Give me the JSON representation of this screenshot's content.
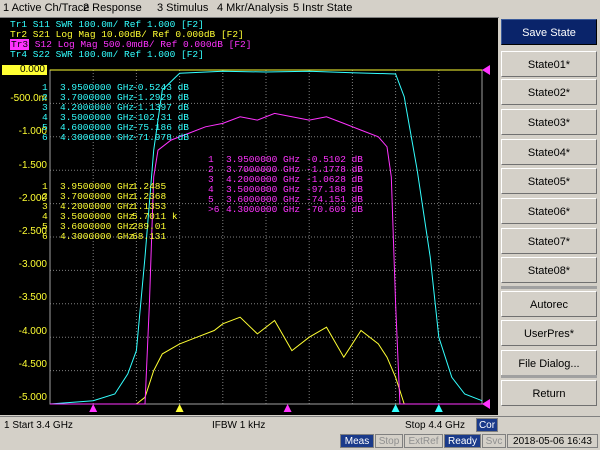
{
  "menu": [
    "1 Active Ch/Trace",
    "2 Response",
    "3 Stimulus",
    "4 Mkr/Analysis",
    "5 Instr State"
  ],
  "traces": [
    {
      "label": "Tr1",
      "text": " S11  SWR 100.0m/ Ref 1.000  [F2]",
      "color": "#33ffff"
    },
    {
      "label": "Tr2",
      "text": " S21  Log Mag 10.00dB/ Ref 0.000dB  [F2]",
      "color": "#ffff33"
    },
    {
      "label": "Tr3",
      "text": " S12  Log Mag 500.0mdB/ Ref 0.000dB  [F2]",
      "color": "#ff33ff"
    },
    {
      "label": "Tr4",
      "text": " S22  SWR 100.0m/ Ref 1.000  [F2]",
      "color": "#33ffff"
    }
  ],
  "y_axis": {
    "top_label": "0.000",
    "labels": [
      "-500.0m",
      "-1.000",
      "-1.500",
      "-2.000",
      "-2.500",
      "-3.000",
      "-3.500",
      "-4.000",
      "-4.500",
      "-5.000"
    ]
  },
  "marker_tables": {
    "cyan": {
      "color": "#33ffff",
      "rows": [
        {
          "n": "1",
          "f": "3.9500000 GHz",
          "v": "-0.5243 dB"
        },
        {
          "n": "2",
          "f": "3.7000000 GHz",
          "v": "-1.2929 dB"
        },
        {
          "n": "3",
          "f": "4.2000000 GHz",
          "v": "-1.1397 dB"
        },
        {
          "n": "4",
          "f": "3.5000000 GHz",
          "v": "-102.31 dB"
        },
        {
          "n": "5",
          "f": "4.6000000 GHz",
          "v": "-75.186 dB"
        },
        {
          "n": "6",
          "f": "4.3000000 GHz",
          "v": "-71.978 dB"
        }
      ]
    },
    "yellow": {
      "color": "#ffff33",
      "rows": [
        {
          "n": "1",
          "f": "3.9500000 GHz",
          "v": "1.2485"
        },
        {
          "n": "2",
          "f": "3.7000000 GHz",
          "v": "1.2368"
        },
        {
          "n": "3",
          "f": "4.2000000 GHz",
          "v": "1.1353"
        },
        {
          "n": "4",
          "f": "3.5000000 GHz",
          "v": "5.7011 k"
        },
        {
          "n": "5",
          "f": "3.6000000 GHz",
          "v": "289.01"
        },
        {
          "n": "6",
          "f": "4.3000000 GHz",
          "v": "68.131"
        }
      ]
    },
    "magenta": {
      "color": "#ff33ff",
      "rows": [
        {
          "n": "1",
          "f": "3.9500000 GHz",
          "v": "-0.5102 dB"
        },
        {
          "n": "2",
          "f": "3.7000000 GHz",
          "v": "-1.1778 dB"
        },
        {
          "n": "3",
          "f": "4.2000000 GHz",
          "v": "-1.0628 dB"
        },
        {
          "n": "4",
          "f": "3.5000000 GHz",
          "v": "-97.188 dB"
        },
        {
          "n": "5",
          "f": "3.6000000 GHz",
          "v": "-74.151 dB"
        },
        {
          "n": ">6",
          "f": "4.3000000 GHz",
          "v": "-70.609 dB"
        }
      ]
    }
  },
  "chart_data": {
    "type": "line",
    "x_unit": "GHz",
    "xlim": [
      3.4,
      4.4
    ],
    "ylim": [
      -5.0,
      0.0
    ],
    "grid": true,
    "series": [
      {
        "name": "Tr1 S11",
        "color": "#33ffff",
        "x": [
          3.4,
          3.5,
          3.55,
          3.58,
          3.6,
          3.62,
          3.64,
          3.66,
          3.7,
          3.8,
          3.9,
          4.0,
          4.1,
          4.2,
          4.22,
          4.25,
          4.28,
          4.3,
          4.33,
          4.36,
          4.4
        ],
        "y": [
          -5.0,
          -4.95,
          -4.85,
          -4.55,
          -4.2,
          -2.8,
          -1.2,
          -0.3,
          -0.05,
          -0.02,
          -0.03,
          -0.02,
          -0.04,
          -0.06,
          -0.4,
          -1.5,
          -2.8,
          -4.0,
          -4.6,
          -4.85,
          -4.95
        ]
      },
      {
        "name": "Tr2 S21",
        "color": "#ffff33",
        "x": [
          3.4,
          3.6,
          3.62,
          3.64,
          3.66,
          3.7,
          3.74,
          3.78,
          3.8,
          3.84,
          3.88,
          3.92,
          3.96,
          4.0,
          4.04,
          4.08,
          4.12,
          4.16,
          4.18,
          4.2,
          4.22,
          4.4
        ],
        "y": [
          -5.0,
          -5.0,
          -4.9,
          -4.5,
          -4.25,
          -4.1,
          -4.0,
          -3.9,
          -3.8,
          -3.7,
          -3.95,
          -3.75,
          -4.2,
          -4.0,
          -3.85,
          -4.3,
          -3.9,
          -4.1,
          -4.3,
          -4.6,
          -5.0,
          -5.0
        ]
      },
      {
        "name": "Tr3 S12",
        "color": "#ff33ff",
        "x": [
          3.4,
          3.62,
          3.63,
          3.64,
          3.65,
          3.68,
          3.72,
          3.76,
          3.8,
          3.84,
          3.88,
          3.92,
          3.96,
          4.0,
          4.04,
          4.08,
          4.12,
          4.16,
          4.18,
          4.19,
          4.2,
          4.21,
          4.4
        ],
        "y": [
          -5.0,
          -5.0,
          -3.5,
          -1.6,
          -1.2,
          -1.05,
          -0.95,
          -0.85,
          -0.8,
          -0.7,
          -0.75,
          -0.65,
          -0.7,
          -0.75,
          -0.7,
          -0.8,
          -0.9,
          -1.0,
          -1.15,
          -1.6,
          -3.5,
          -5.0,
          -5.0
        ]
      }
    ],
    "markers": [
      3.95,
      3.7,
      4.2,
      3.5,
      4.6,
      4.3
    ]
  },
  "softkeys": [
    "Save State",
    "State01*",
    "State02*",
    "State03*",
    "State04*",
    "State05*",
    "State06*",
    "State07*",
    "State08*",
    "Autorec",
    "UserPres*",
    "File Dialog...",
    "Return"
  ],
  "status": {
    "start": "1 Start 3.4 GHz",
    "ifbw": "IFBW 1 kHz",
    "stop": "Stop 4.4 GHz",
    "cor": "Cor"
  },
  "bottom": {
    "meas": "Meas",
    "stop": "Stop",
    "extref": "ExtRef",
    "ready": "Ready",
    "svc": "Svc",
    "datetime": "2018-05-06 16:43"
  }
}
